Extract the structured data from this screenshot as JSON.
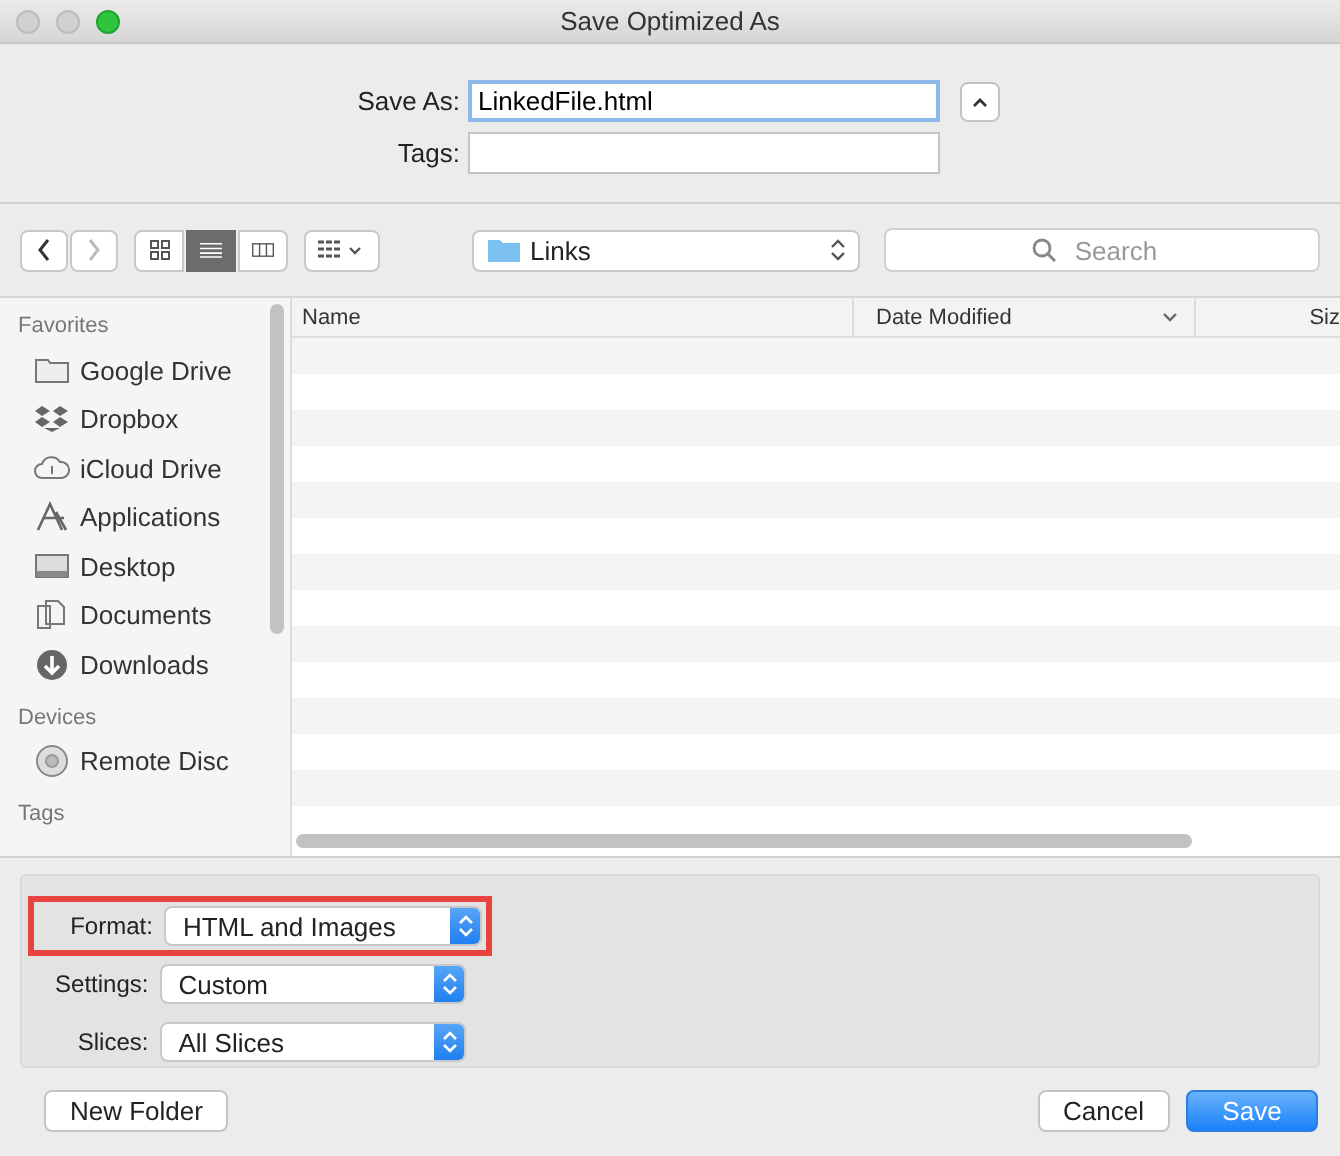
{
  "window": {
    "title": "Save Optimized As"
  },
  "save_as": {
    "label": "Save As:",
    "value": "LinkedFile.html"
  },
  "tags": {
    "label": "Tags:"
  },
  "toolbar": {
    "view_modes": [
      {
        "kind": "icons",
        "selected": false
      },
      {
        "kind": "list",
        "selected": true
      },
      {
        "kind": "columns",
        "selected": false
      }
    ],
    "location": "Links",
    "search": {
      "placeholder": "Search"
    }
  },
  "sidebar": {
    "sections": [
      {
        "title": "Favorites",
        "items": [
          {
            "kind": "folder",
            "label": "Google Drive"
          },
          {
            "kind": "dropbox",
            "label": "Dropbox"
          },
          {
            "kind": "cloud",
            "label": "iCloud Drive"
          },
          {
            "kind": "apps",
            "label": "Applications"
          },
          {
            "kind": "desktop",
            "label": "Desktop"
          },
          {
            "kind": "documents",
            "label": "Documents"
          },
          {
            "kind": "downloads",
            "label": "Downloads"
          }
        ]
      },
      {
        "title": "Devices",
        "items": [
          {
            "kind": "disc",
            "label": "Remote Disc"
          }
        ]
      },
      {
        "title": "Tags"
      }
    ]
  },
  "table": {
    "columns": [
      {
        "label": "Name",
        "sorted": false
      },
      {
        "label": "Date Modified",
        "sorted": true
      },
      {
        "label": "Siz",
        "sorted": false
      }
    ]
  },
  "options": [
    {
      "label": "Format:",
      "value": "HTML and Images",
      "highlighted": true
    },
    {
      "label": "Settings:",
      "value": "Custom",
      "highlighted": false
    },
    {
      "label": "Slices:",
      "value": "All Slices",
      "highlighted": false
    }
  ],
  "buttons": [
    {
      "label": "New Folder",
      "kind": "plain"
    },
    {
      "label": "Cancel",
      "kind": "plain"
    },
    {
      "label": "Save",
      "kind": "default"
    }
  ]
}
